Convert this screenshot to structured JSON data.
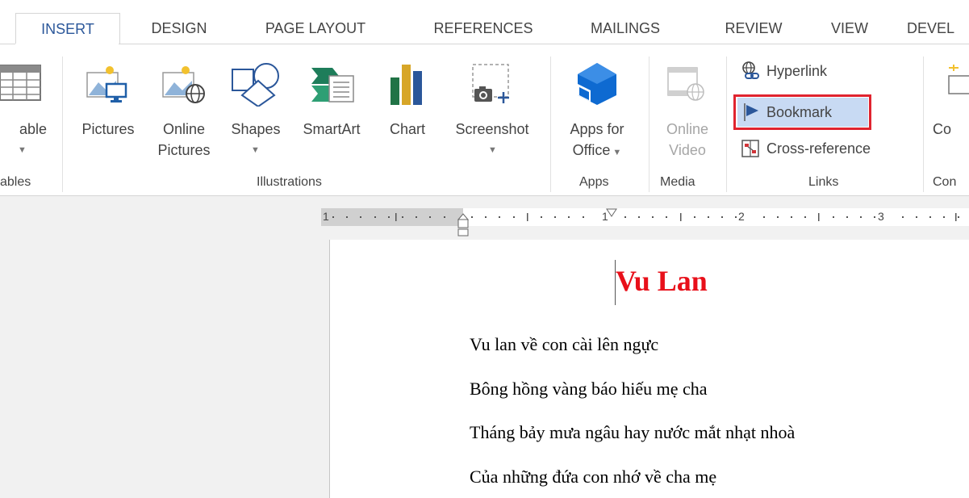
{
  "tabs": [
    {
      "label": "INSERT",
      "active": true
    },
    {
      "label": "DESIGN"
    },
    {
      "label": "PAGE LAYOUT"
    },
    {
      "label": "REFERENCES"
    },
    {
      "label": "MAILINGS"
    },
    {
      "label": "REVIEW"
    },
    {
      "label": "VIEW"
    },
    {
      "label": "DEVEL"
    }
  ],
  "ribbon": {
    "tables": {
      "button_label": "able",
      "group_label": "ables"
    },
    "illustrations": {
      "group_label": "Illustrations",
      "pictures": "Pictures",
      "online_pictures_line1": "Online",
      "online_pictures_line2": "Pictures",
      "shapes": "Shapes",
      "smartart": "SmartArt",
      "chart": "Chart",
      "screenshot": "Screenshot"
    },
    "apps": {
      "group_label": "Apps",
      "line1": "Apps for",
      "line2": "Office"
    },
    "media": {
      "group_label": "Media",
      "line1": "Online",
      "line2": "Video"
    },
    "links": {
      "group_label": "Links",
      "hyperlink": "Hyperlink",
      "bookmark": "Bookmark",
      "cross_reference": "Cross-reference"
    },
    "comments": {
      "button_label": "Co",
      "group_label": "Con"
    }
  },
  "ruler": {
    "numbers": [
      "1",
      "1",
      "2",
      "3"
    ]
  },
  "document": {
    "title": "Vu Lan",
    "lines": [
      "Vu lan về con cài lên ngực",
      "Bông hồng vàng báo hiếu mẹ cha",
      "Tháng bảy mưa ngâu hay nước mắt nhạt nhoà",
      "Của những đứa con nhớ về cha mẹ"
    ]
  },
  "colors": {
    "accent": "#2b579a",
    "highlight_box": "#e0242f",
    "title": "#e8101a"
  }
}
